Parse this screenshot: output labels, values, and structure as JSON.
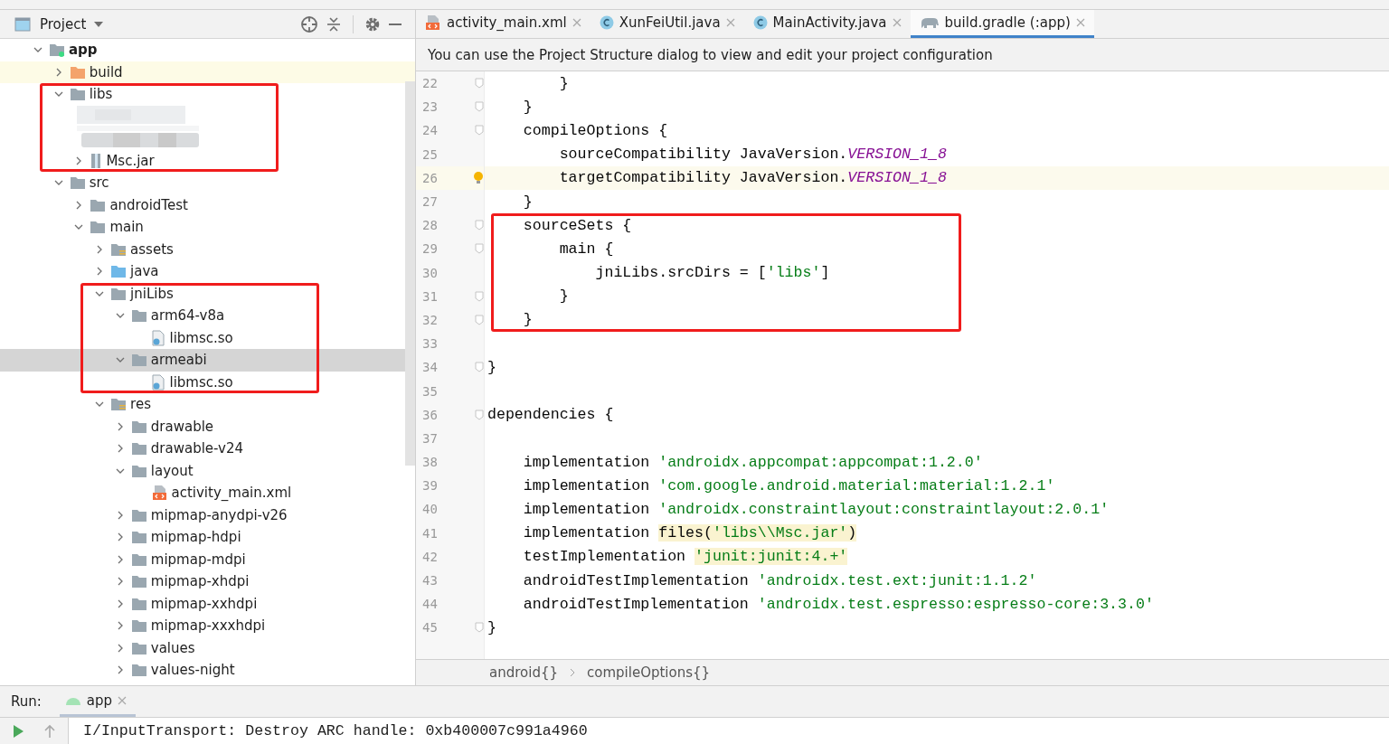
{
  "project_panel": {
    "title": "Project",
    "tree": [
      {
        "label": "app",
        "kind": "module",
        "expanded": true,
        "selected": false,
        "children": [
          {
            "label": "build",
            "kind": "excluded",
            "expanded": false,
            "selected": false,
            "highlighted": true
          },
          {
            "label": "libs",
            "kind": "folder",
            "expanded": true,
            "selected": false,
            "outlined": true,
            "children": [
              {
                "kind": "redacted"
              },
              {
                "label": "Msc.jar",
                "kind": "jar",
                "expanded": false,
                "selected": false
              }
            ]
          },
          {
            "label": "src",
            "kind": "folder",
            "expanded": true,
            "selected": false,
            "children": [
              {
                "label": "androidTest",
                "kind": "folder",
                "expanded": false,
                "selected": false
              },
              {
                "label": "main",
                "kind": "folder",
                "expanded": true,
                "selected": false,
                "children": [
                  {
                    "label": "assets",
                    "kind": "resources",
                    "expanded": false,
                    "selected": false
                  },
                  {
                    "label": "java",
                    "kind": "source",
                    "expanded": false,
                    "selected": false
                  },
                  {
                    "label": "jniLibs",
                    "kind": "folder",
                    "expanded": true,
                    "selected": false,
                    "outlined": true,
                    "children": [
                      {
                        "label": "arm64-v8a",
                        "kind": "folder",
                        "expanded": true,
                        "selected": false,
                        "children": [
                          {
                            "label": "libmsc.so",
                            "kind": "so",
                            "selected": false
                          }
                        ]
                      },
                      {
                        "label": "armeabi",
                        "kind": "folder",
                        "expanded": true,
                        "selected": true,
                        "children": [
                          {
                            "label": "libmsc.so",
                            "kind": "so",
                            "selected": false
                          }
                        ]
                      }
                    ]
                  },
                  {
                    "label": "res",
                    "kind": "resources",
                    "expanded": true,
                    "selected": false,
                    "children": [
                      {
                        "label": "drawable",
                        "kind": "folder",
                        "expanded": false,
                        "selected": false
                      },
                      {
                        "label": "drawable-v24",
                        "kind": "folder",
                        "expanded": false,
                        "selected": false
                      },
                      {
                        "label": "layout",
                        "kind": "folder",
                        "expanded": true,
                        "selected": false,
                        "children": [
                          {
                            "label": "activity_main.xml",
                            "kind": "xml",
                            "selected": false
                          }
                        ]
                      },
                      {
                        "label": "mipmap-anydpi-v26",
                        "kind": "folder",
                        "expanded": false,
                        "selected": false
                      },
                      {
                        "label": "mipmap-hdpi",
                        "kind": "folder",
                        "expanded": false,
                        "selected": false
                      },
                      {
                        "label": "mipmap-mdpi",
                        "kind": "folder",
                        "expanded": false,
                        "selected": false
                      },
                      {
                        "label": "mipmap-xhdpi",
                        "kind": "folder",
                        "expanded": false,
                        "selected": false
                      },
                      {
                        "label": "mipmap-xxhdpi",
                        "kind": "folder",
                        "expanded": false,
                        "selected": false
                      },
                      {
                        "label": "mipmap-xxxhdpi",
                        "kind": "folder",
                        "expanded": false,
                        "selected": false
                      },
                      {
                        "label": "values",
                        "kind": "folder",
                        "expanded": false,
                        "selected": false
                      },
                      {
                        "label": "values-night",
                        "kind": "folder",
                        "expanded": false,
                        "selected": false
                      }
                    ]
                  }
                ]
              }
            ]
          }
        ]
      }
    ]
  },
  "editor": {
    "tabs": [
      {
        "label": "activity_main.xml",
        "kind": "xml",
        "selected": false
      },
      {
        "label": "XunFeiUtil.java",
        "kind": "class",
        "selected": false
      },
      {
        "label": "MainActivity.java",
        "kind": "class",
        "selected": false
      },
      {
        "label": "build.gradle (:app)",
        "kind": "gradle",
        "selected": true
      }
    ],
    "notice": "You can use the Project Structure dialog to view and edit your project configuration",
    "lines": [
      {
        "number": "22",
        "fold": true,
        "tokens": [
          {
            "text": "        }",
            "kind": "plain"
          }
        ]
      },
      {
        "number": "23",
        "fold": true,
        "tokens": [
          {
            "text": "    }",
            "kind": "plain"
          }
        ]
      },
      {
        "number": "24",
        "fold": true,
        "tokens": [
          {
            "text": "    compileOptions {",
            "kind": "plain"
          }
        ]
      },
      {
        "number": "25",
        "tokens": [
          {
            "text": "        sourceCompatibility JavaVersion.",
            "kind": "plain"
          },
          {
            "text": "VERSION_1_8",
            "kind": "constant"
          }
        ]
      },
      {
        "number": "26",
        "current": true,
        "bulb": true,
        "tokens": [
          {
            "text": "        targetCompatibility JavaVersion.",
            "kind": "plain"
          },
          {
            "text": "VERSION_1_8",
            "kind": "constant"
          }
        ]
      },
      {
        "number": "27",
        "tokens": [
          {
            "text": "    }",
            "kind": "plain"
          }
        ]
      },
      {
        "number": "28",
        "fold": true,
        "outlined": true,
        "tokens": [
          {
            "text": "    sourceSets {",
            "kind": "plain"
          }
        ]
      },
      {
        "number": "29",
        "fold": true,
        "outlined": true,
        "tokens": [
          {
            "text": "        main {",
            "kind": "plain"
          }
        ]
      },
      {
        "number": "30",
        "outlined": true,
        "tokens": [
          {
            "text": "            jniLibs.srcDirs = [",
            "kind": "plain"
          },
          {
            "text": "'libs'",
            "kind": "string"
          },
          {
            "text": "]",
            "kind": "plain"
          }
        ]
      },
      {
        "number": "31",
        "fold": true,
        "outlined": true,
        "tokens": [
          {
            "text": "        }",
            "kind": "plain"
          }
        ]
      },
      {
        "number": "32",
        "fold": true,
        "outlined": true,
        "tokens": [
          {
            "text": "    }",
            "kind": "plain"
          }
        ]
      },
      {
        "number": "33"
      },
      {
        "number": "34",
        "fold": true,
        "tokens": [
          {
            "text": "}",
            "kind": "plain"
          }
        ]
      },
      {
        "number": "35"
      },
      {
        "number": "36",
        "fold": true,
        "tokens": [
          {
            "text": "dependencies {",
            "kind": "plain"
          }
        ]
      },
      {
        "number": "37"
      },
      {
        "number": "38",
        "tokens": [
          {
            "text": "    implementation ",
            "kind": "plain"
          },
          {
            "text": "'androidx.appcompat:appcompat:1.2.0'",
            "kind": "string"
          }
        ]
      },
      {
        "number": "39",
        "tokens": [
          {
            "text": "    implementation ",
            "kind": "plain"
          },
          {
            "text": "'com.google.android.material:material:1.2.1'",
            "kind": "string"
          }
        ]
      },
      {
        "number": "40",
        "tokens": [
          {
            "text": "    implementation ",
            "kind": "plain"
          },
          {
            "text": "'androidx.constraintlayout:constraintlayout:2.0.1'",
            "kind": "string"
          }
        ]
      },
      {
        "number": "41",
        "tokens": [
          {
            "text": "    implementation ",
            "kind": "plain"
          },
          {
            "text": "files(",
            "kind": "warn"
          },
          {
            "text": "'libs\\\\Msc.jar'",
            "kind": "warn-string"
          },
          {
            "text": ")",
            "kind": "warn"
          }
        ]
      },
      {
        "number": "42",
        "tokens": [
          {
            "text": "    testImplementation ",
            "kind": "plain"
          },
          {
            "text": "'junit:junit:4.+'",
            "kind": "warn-string"
          }
        ]
      },
      {
        "number": "43",
        "tokens": [
          {
            "text": "    androidTestImplementation ",
            "kind": "plain"
          },
          {
            "text": "'androidx.test.ext:junit:1.1.2'",
            "kind": "string"
          }
        ]
      },
      {
        "number": "44",
        "tokens": [
          {
            "text": "    androidTestImplementation ",
            "kind": "plain"
          },
          {
            "text": "'androidx.test.espresso:espresso-core:3.3.0'",
            "kind": "string"
          }
        ]
      },
      {
        "number": "45",
        "fold": true,
        "tokens": [
          {
            "text": "}",
            "kind": "plain"
          }
        ]
      }
    ],
    "breadcrumbs": [
      "android{}",
      "compileOptions{}"
    ]
  },
  "run_panel": {
    "label": "Run:",
    "tab": "app",
    "console_line": "I/InputTransport: Destroy ARC handle: 0xb400007c991a4960"
  }
}
